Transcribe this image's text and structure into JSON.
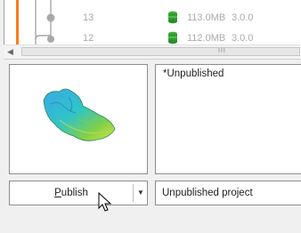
{
  "history": {
    "rows": [
      {
        "number": "13",
        "size": "113.0MB",
        "version": "3.0.0",
        "icon": "database-icon"
      },
      {
        "number": "12",
        "size": "112.0MB",
        "version": "3.0.0",
        "icon": "database-icon"
      }
    ],
    "graph_colors": {
      "branch": "#ff7a1a",
      "line": "#a0a0a0",
      "db_icon": "#2f9e2f"
    }
  },
  "scrollbar": {
    "grip": "III"
  },
  "description": {
    "text": "*Unpublished"
  },
  "publish_button": {
    "prefix_underlined": "P",
    "rest": "ublish"
  },
  "status": {
    "text": "Unpublished project"
  }
}
